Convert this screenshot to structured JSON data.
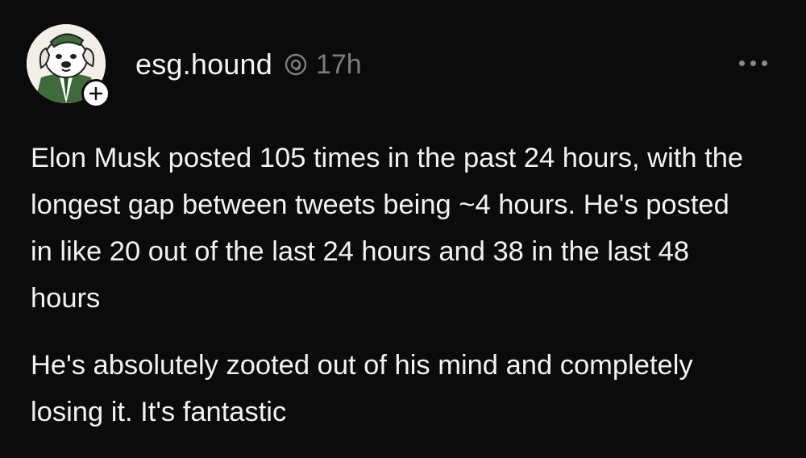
{
  "post": {
    "username": "esg.hound",
    "timestamp": "17h",
    "paragraphs": [
      "Elon Musk posted 105 times in the past 24 hours, with the longest gap between tweets being ~4 hours. He's posted in like 20 out of the last 24 hours and 38 in the last 48 hours",
      "He's absolutely zooted out of his mind and completely losing it. It's fantastic"
    ],
    "icons": {
      "avatar": "cartoon-dog-avatar",
      "follow": "plus-icon",
      "verified": "threads-logo-icon",
      "more": "more-horizontal-icon"
    }
  }
}
